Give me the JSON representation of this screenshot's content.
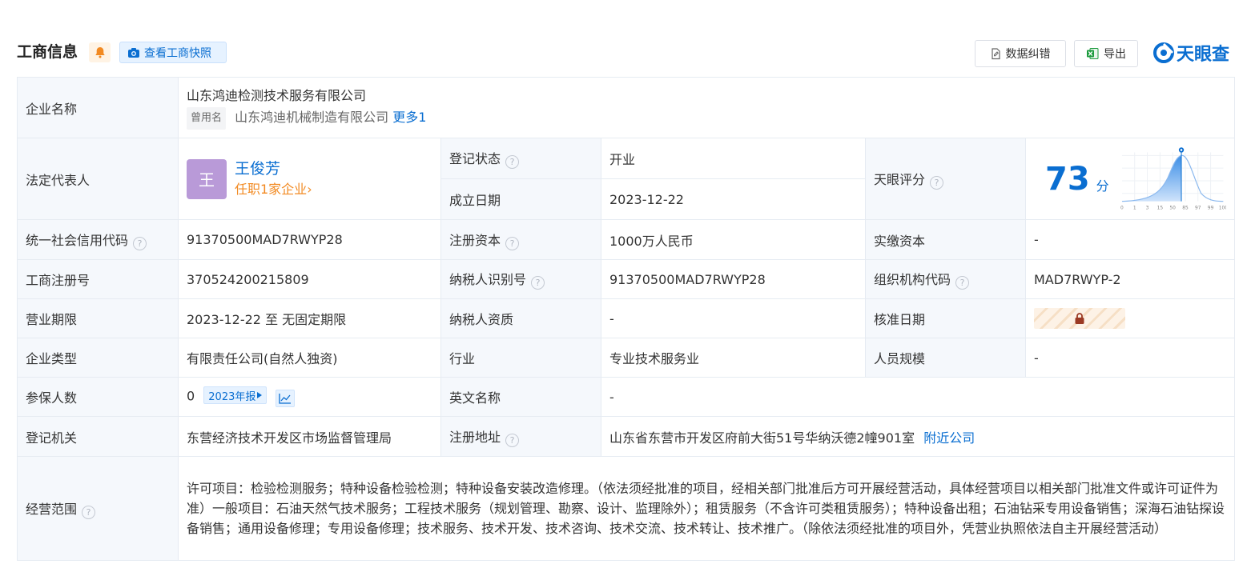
{
  "header": {
    "title": "工商信息",
    "snapshot_label": "查看工商快照",
    "correct_label": "数据纠错",
    "export_label": "导出",
    "logo_text": "天眼查"
  },
  "company": {
    "label": "企业名称",
    "name": "山东鸿迪检测技术服务有限公司",
    "used_tag": "曾用名",
    "used_name": "山东鸿迪机械制造有限公司",
    "more": "更多1"
  },
  "legal": {
    "label": "法定代表人",
    "avatar_char": "王",
    "name": "王俊芳",
    "sub": "任职1家企业",
    "sub_arrow": "›"
  },
  "status": {
    "label": "登记状态",
    "value": "开业"
  },
  "founded": {
    "label": "成立日期",
    "value": "2023-12-22"
  },
  "score": {
    "label": "天眼评分",
    "value": "73",
    "unit": "分",
    "axis_ticks": [
      "0",
      "1",
      "3",
      "15",
      "50",
      "85",
      "97",
      "99",
      "100"
    ]
  },
  "credit_code": {
    "label": "统一社会信用代码",
    "value": "91370500MAD7RWYP28"
  },
  "reg_capital": {
    "label": "注册资本",
    "value": "1000万人民币"
  },
  "paid_capital": {
    "label": "实缴资本",
    "value": "-"
  },
  "reg_no": {
    "label": "工商注册号",
    "value": "370524200215809"
  },
  "tax_id": {
    "label": "纳税人识别号",
    "value": "91370500MAD7RWYP28"
  },
  "org_code": {
    "label": "组织机构代码",
    "value": "MAD7RWYP-2"
  },
  "term": {
    "label": "营业期限",
    "value": "2023-12-22 至 无固定期限"
  },
  "tax_qual": {
    "label": "纳税人资质",
    "value": "-"
  },
  "approve_date": {
    "label": "核准日期"
  },
  "type": {
    "label": "企业类型",
    "value": "有限责任公司(自然人独资)"
  },
  "industry": {
    "label": "行业",
    "value": "专业技术服务业"
  },
  "staff": {
    "label": "人员规模",
    "value": "-"
  },
  "insured": {
    "label": "参保人数",
    "value": "0",
    "year_tag": "2023年报"
  },
  "en_name": {
    "label": "英文名称",
    "value": "-"
  },
  "authority": {
    "label": "登记机关",
    "value": "东营经济技术开发区市场监督管理局"
  },
  "address": {
    "label": "注册地址",
    "value": "山东省东营市开发区府前大街51号华纳沃德2幢901室",
    "nearby": "附近公司"
  },
  "scope": {
    "label": "经营范围",
    "value": "许可项目：检验检测服务；特种设备检验检测；特种设备安装改造修理。（依法须经批准的项目，经相关部门批准后方可开展经营活动，具体经营项目以相关部门批准文件或许可证件为准）一般项目：石油天然气技术服务；工程技术服务（规划管理、勘察、设计、监理除外）；租赁服务（不含许可类租赁服务）；特种设备出租；石油钻采专用设备销售；深海石油钻探设备销售；通用设备修理；专用设备修理；技术服务、技术开发、技术咨询、技术交流、技术转让、技术推广。（除依法须经批准的项目外，凭营业执照依法自主开展经营活动）"
  },
  "colors": {
    "brand": "#0a6ed1",
    "label_bg": "#f5f8fc",
    "border": "#e6ebf2",
    "green": "#1c9b3e",
    "orange": "#f28a22"
  }
}
